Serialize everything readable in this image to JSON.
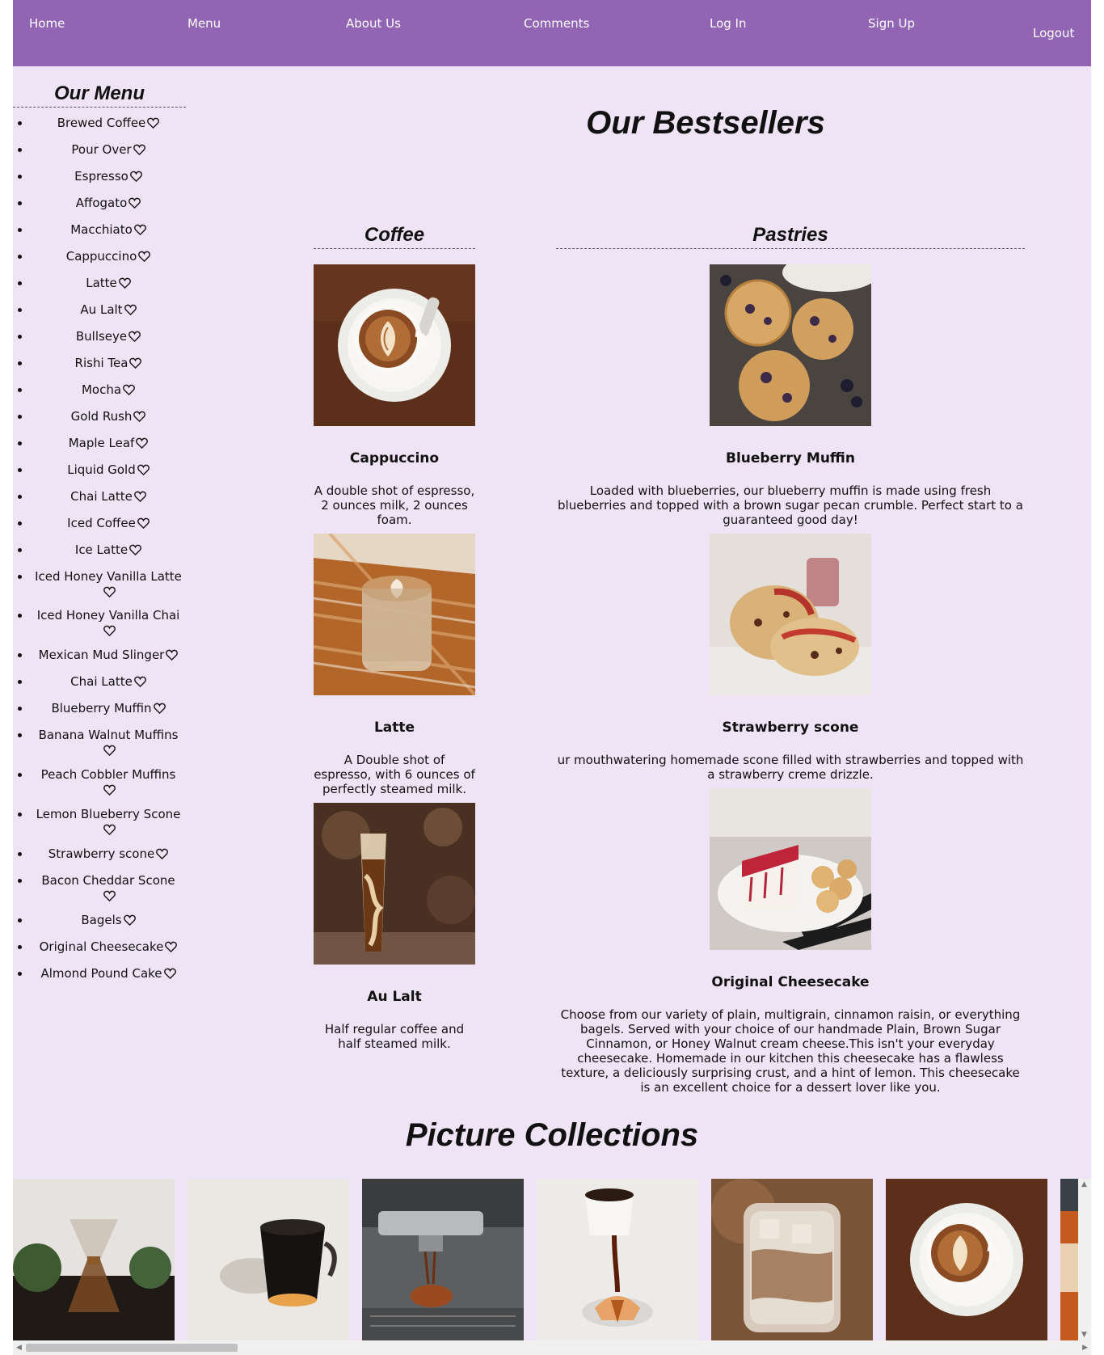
{
  "nav": {
    "home": "Home",
    "menu": "Menu",
    "about": "About Us",
    "comments": "Comments",
    "login": "Log In",
    "signup": "Sign Up",
    "logout": "Logout"
  },
  "sidebar": {
    "title": "Our Menu",
    "items": [
      "Brewed Coffee",
      "Pour Over",
      "Espresso",
      "Affogato",
      "Macchiato",
      "Cappuccino",
      "Latte",
      "Au Lalt",
      "Bullseye",
      "Rishi Tea",
      "Mocha",
      "Gold Rush",
      "Maple Leaf",
      "Liquid Gold",
      "Chai Latte",
      "Iced Coffee",
      "Ice Latte",
      "Iced Honey Vanilla Latte",
      "Iced Honey Vanilla Chai",
      "Mexican Mud Slinger",
      "Chai Latte",
      "Blueberry Muffin",
      "Banana Walnut Muffins",
      "Peach Cobbler Muffins",
      "Lemon Blueberry Scone",
      "Strawberry scone",
      "Bacon Cheddar Scone",
      "Bagels",
      "Original Cheesecake",
      "Almond Pound Cake"
    ]
  },
  "bestsellers": {
    "title": "Our Bestsellers",
    "coffee": {
      "title": "Coffee",
      "items": [
        {
          "name": "Cappuccino",
          "desc": "A double shot of espresso, 2 ounces milk, 2 ounces foam."
        },
        {
          "name": "Latte",
          "desc": "A Double shot of espresso, with 6 ounces of perfectly steamed milk."
        },
        {
          "name": "Au Lalt",
          "desc": "Half regular coffee and half steamed milk."
        }
      ]
    },
    "pastries": {
      "title": "Pastries",
      "items": [
        {
          "name": "Blueberry Muffin",
          "desc": "Loaded with blueberries, our blueberry muffin is made using fresh blueberries and topped with a brown sugar pecan crumble. Perfect start to a guaranteed good day!"
        },
        {
          "name": "Strawberry scone",
          "desc": "ur mouthwatering homemade scone filled with strawberries and topped with a strawberry creme drizzle."
        },
        {
          "name": "Original Cheesecake",
          "desc": "Choose from our variety of plain, multigrain, cinnamon raisin, or everything bagels. Served with your choice of our handmade Plain, Brown Sugar Cinnamon, or Honey Walnut cream cheese.This isn't your everyday cheesecake. Homemade in our kitchen this cheesecake has a flawless texture, a deliciously surprising crust, and a hint of lemon. This cheesecake is an excellent choice for a dessert lover like you."
        }
      ]
    }
  },
  "collections": {
    "title": "Picture Collections"
  },
  "colors": {
    "nav": "#9264b4",
    "page": "#efe3f6"
  }
}
